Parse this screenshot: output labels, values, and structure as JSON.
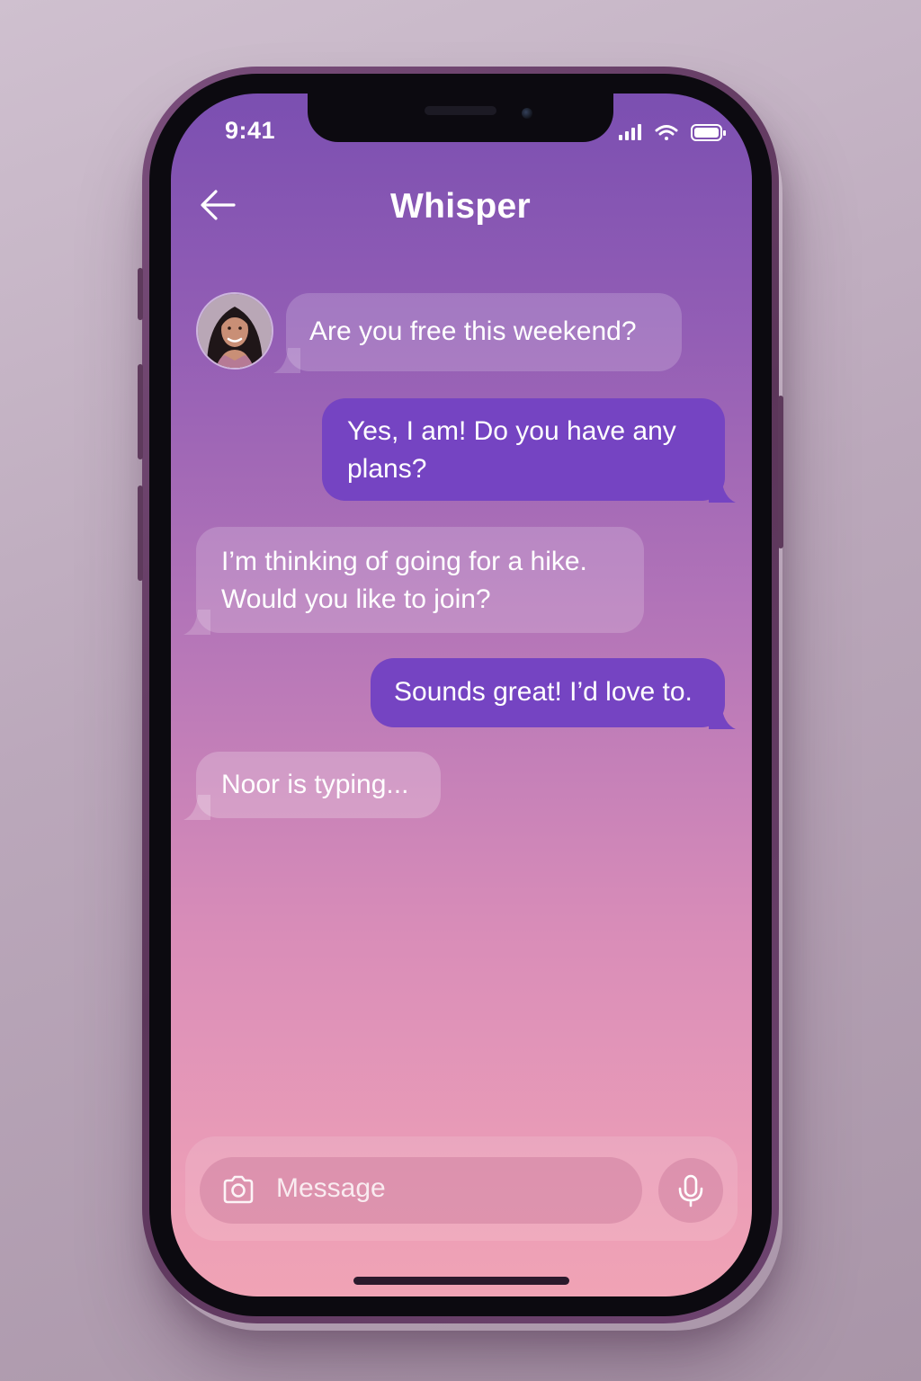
{
  "status_bar": {
    "time": "9:41",
    "icons": [
      "signal-icon",
      "wifi-icon",
      "battery-icon"
    ]
  },
  "header": {
    "title": "Whisper",
    "back_icon": "back-arrow-icon"
  },
  "conversation": {
    "contact_name": "Noor",
    "messages": [
      {
        "direction": "incoming",
        "lines": [
          "Are you free this weekend?"
        ]
      },
      {
        "direction": "outgoing",
        "lines": [
          "Yes, I am! Do you have any",
          "plans?"
        ]
      },
      {
        "direction": "incoming",
        "lines": [
          "I’m thinking of going for a hike.",
          "Would you like to join?"
        ]
      },
      {
        "direction": "outgoing",
        "lines": [
          "Sounds great! I’d love to."
        ]
      }
    ],
    "typing_indicator": "Noor is typing..."
  },
  "composer": {
    "placeholder": "Message",
    "camera_icon": "camera-icon",
    "mic_icon": "microphone-icon"
  },
  "colors": {
    "outgoing_bubble": "#7544c2",
    "incoming_bubble": "rgba(255,255,255,0.18)",
    "background_top": "#7b4fb1",
    "background_bottom": "#f0a3b5"
  }
}
